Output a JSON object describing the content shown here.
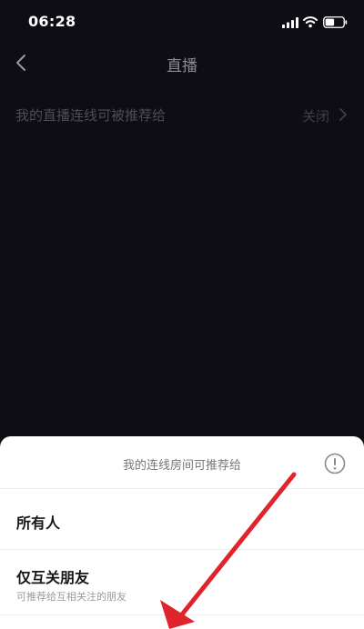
{
  "status_bar": {
    "time": "06:28"
  },
  "nav": {
    "title": "直播"
  },
  "setting": {
    "label": "我的直播连线可被推荐给",
    "value": "关闭"
  },
  "sheet": {
    "title": "我的连线房间可推荐给",
    "options": [
      {
        "label": "所有人"
      },
      {
        "label": "仅互关朋友",
        "description": "可推荐给互相关注的朋友"
      }
    ]
  },
  "colors": {
    "background": "#0e0d13",
    "sheet": "#ffffff",
    "annotation_arrow": "#e0242b"
  },
  "icons": [
    "signal-icon",
    "wifi-icon",
    "battery-icon",
    "back-icon",
    "chevron-right-icon",
    "info-icon",
    "arrow-annotation"
  ]
}
